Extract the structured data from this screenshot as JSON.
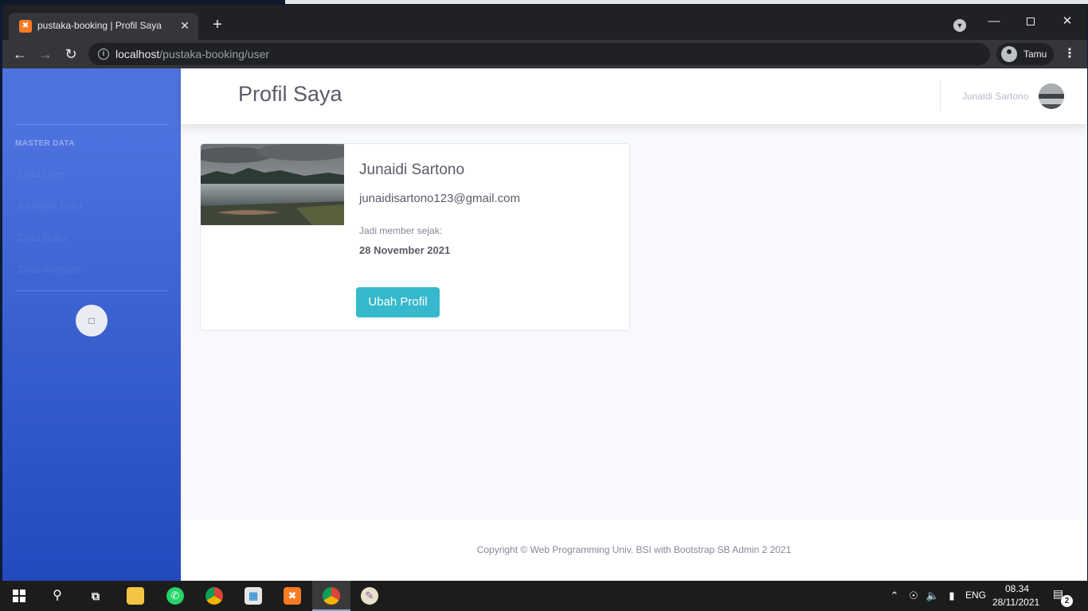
{
  "browser": {
    "tab_title": "pustaka-booking | Profil Saya",
    "favicon": "xampp-icon",
    "url_host": "localhost",
    "url_path": "/pustaka-booking/user",
    "profile_name": "Tamu"
  },
  "sidebar": {
    "heading": "MASTER DATA",
    "items": [
      {
        "label": "Data User"
      },
      {
        "label": "Kategori buku"
      },
      {
        "label": "Data Buku"
      },
      {
        "label": "Data Anggota"
      }
    ],
    "toggle_icon": "chevron-left-icon"
  },
  "topbar": {
    "page_title": "Profil Saya",
    "user_name": "Junaidi Sartono"
  },
  "profile": {
    "name": "Junaidi Sartono",
    "email": "junaidisartono123@gmail.com",
    "member_since_label": "Jadi member sejak:",
    "member_since_date": "28 November 2021",
    "edit_button": "Ubah Profil"
  },
  "footer": {
    "copyright": "Copyright © Web Programming Univ. BSI with Bootstrap SB Admin 2 2021"
  },
  "taskbar": {
    "apps": [
      "start-button",
      "search",
      "task-view",
      "file-explorer",
      "whatsapp",
      "chrome",
      "microsoft-store",
      "xampp",
      "chrome-active",
      "paint"
    ],
    "language": "ENG",
    "time": "08.34",
    "date": "28/11/2021",
    "notifications": "2"
  },
  "colors": {
    "sidebar_top": "#4e73df",
    "sidebar_bottom": "#224abe",
    "button_info": "#36b9cc"
  }
}
